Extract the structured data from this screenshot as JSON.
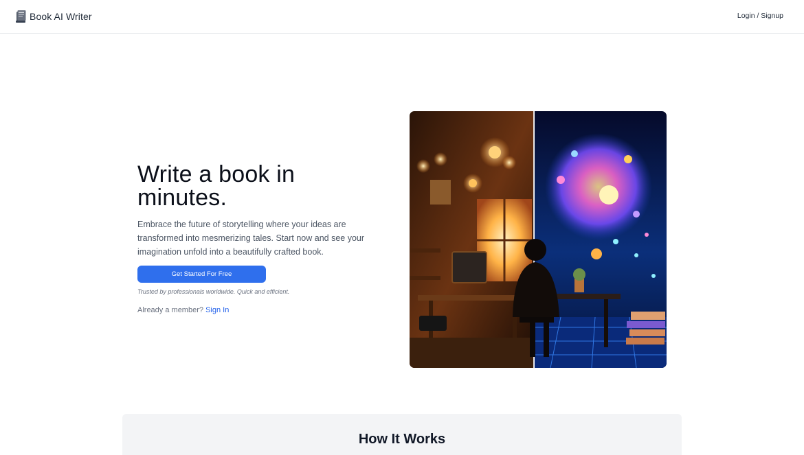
{
  "header": {
    "brand_name": "Book AI Writer",
    "brand_icon": "book-icon",
    "login_label": "Login / Signup"
  },
  "hero": {
    "title": "Write a book in minutes.",
    "subtitle": "Embrace the future of storytelling where your ideas are transformed into mesmerizing tales. Start now and see your imagination unfold into a beautifully crafted book.",
    "cta_label": "Get Started For Free",
    "trust_text": "Trusted by professionals worldwide. Quick and efficient.",
    "member_prompt": "Already a member?",
    "sign_in_label": "Sign In"
  },
  "how_it_works": {
    "title": "How It Works"
  },
  "colors": {
    "accent": "#2f6fed",
    "link": "#2563eb",
    "section_bg": "#f3f4f6"
  }
}
